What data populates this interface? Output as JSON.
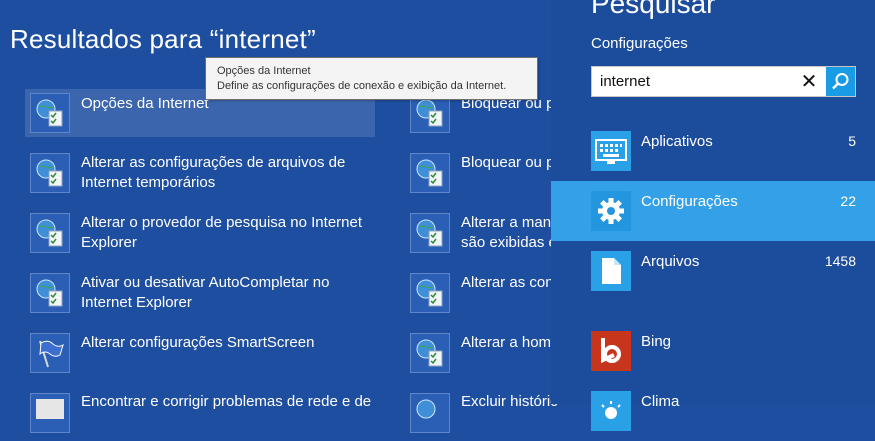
{
  "results": {
    "title": "Resultados para “internet”",
    "items": [
      {
        "label": "Opções da Internet",
        "icon": "internet-options-icon"
      },
      {
        "label": "Alterar as configurações de arquivos de\nInternet temporários",
        "icon": "internet-options-icon"
      },
      {
        "label": "Alterar o provedor de pesquisa no Internet\nExplorer",
        "icon": "internet-options-icon"
      },
      {
        "label": "Ativar ou desativar AutoCompletar no\nInternet Explorer",
        "icon": "internet-options-icon"
      },
      {
        "label": "Alterar configurações SmartScreen",
        "icon": "smartscreen-flag-icon"
      },
      {
        "label": "Encontrar e corrigir problemas de rede e de",
        "icon": "troubleshoot-icon"
      }
    ],
    "items_col2": [
      {
        "label": "Bloquear ou p",
        "icon": "internet-options-icon"
      },
      {
        "label": "Bloquear ou p",
        "icon": "internet-options-icon"
      },
      {
        "label": "Alterar a mane\nsão exibidas e",
        "icon": "internet-options-icon"
      },
      {
        "label": "Alterar as con",
        "icon": "internet-options-icon"
      },
      {
        "label": "Alterar a hom",
        "icon": "internet-options-icon"
      },
      {
        "label": "Excluir históric",
        "icon": "internet-options-icon"
      }
    ]
  },
  "tooltip": {
    "title": "Opções da Internet",
    "description": "Define as configurações de conexão e exibição da Internet."
  },
  "search": {
    "pane_title": "Pesquisar",
    "scope": "Configurações",
    "query": "internet",
    "clear_glyph": "✕"
  },
  "scopes": [
    {
      "name": "Aplicativos",
      "count": "5",
      "icon": "apps-keyboard-icon"
    },
    {
      "name": "Configurações",
      "count": "22",
      "icon": "gear-icon",
      "active": true
    },
    {
      "name": "Arquivos",
      "count": "1458",
      "icon": "file-icon"
    },
    {
      "name": "Bing",
      "count": "",
      "icon": "bing-icon"
    },
    {
      "name": "Clima",
      "count": "",
      "icon": "weather-icon"
    }
  ],
  "colors": {
    "background": "#1e4ea0",
    "pane": "#1c4c9c",
    "accent": "#33a0e8",
    "bing": "#c7361c"
  }
}
